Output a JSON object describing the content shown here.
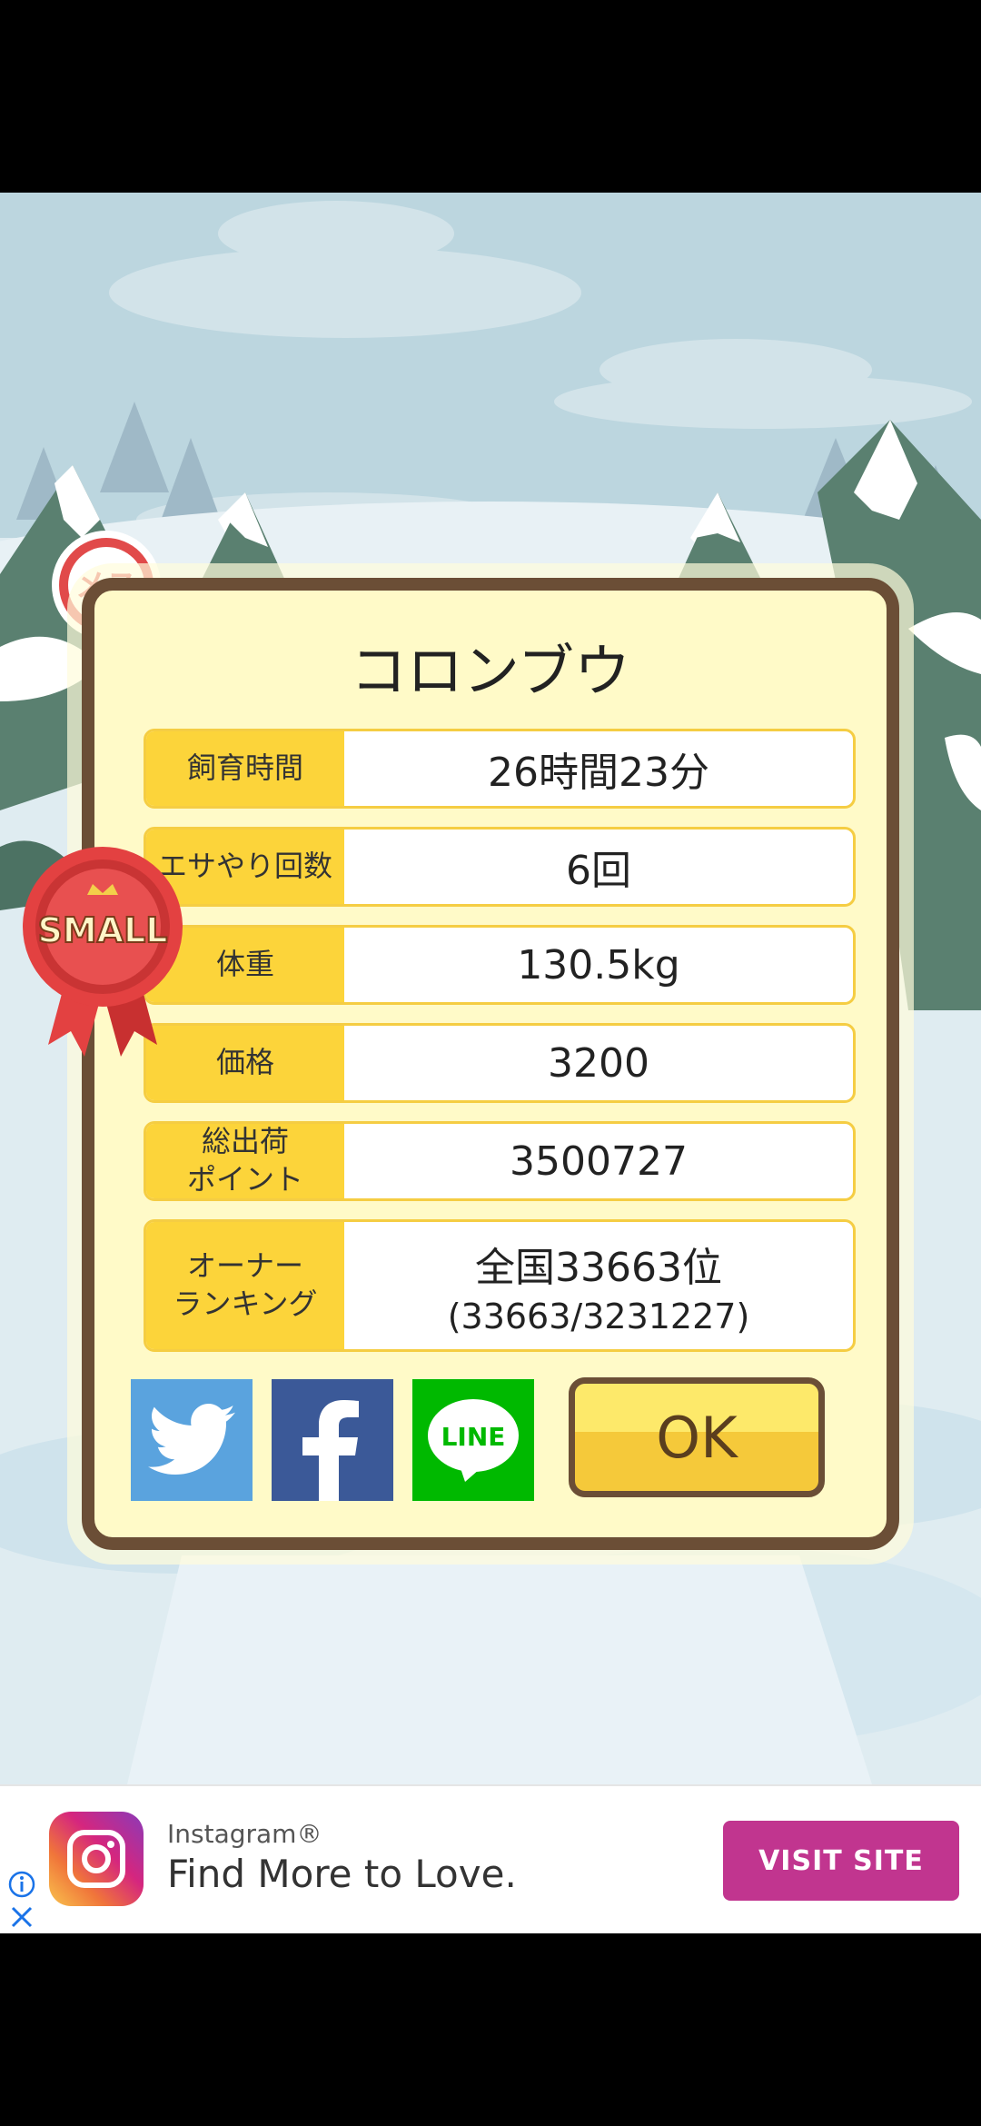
{
  "dialog": {
    "title": "コロンブウ",
    "rows": [
      {
        "label": "飼育時間",
        "value": "26時間23分"
      },
      {
        "label": "エサやり回数",
        "value": "6回"
      },
      {
        "label": "体重",
        "value": "130.5kg"
      },
      {
        "label": "価格",
        "value": "3200"
      },
      {
        "label": "総出荷\nポイント",
        "value": "3500727"
      },
      {
        "label": "オーナー\nランキング",
        "value": "全国33663位",
        "sub": "(33663/3231227)"
      }
    ],
    "share": {
      "twitter_icon": "twitter-bird-icon",
      "facebook_icon": "facebook-f-icon",
      "line_label": "LINE"
    },
    "ok_label": "OK"
  },
  "badges": {
    "female_label": "メス",
    "size_label": "SMALL"
  },
  "ad": {
    "brand": "Instagram®",
    "headline": "Find More to Love.",
    "cta": "VISIT SITE",
    "info_icon": "info-icon",
    "close_icon": "close-icon"
  },
  "colors": {
    "dialog_bg": "#fffac8",
    "dialog_border": "#6b4e36",
    "label_bg": "#fcd43a",
    "twitter": "#5aa3de",
    "facebook": "#3b5998",
    "line": "#00b900",
    "ok_button": "#f5c93a",
    "ad_cta": "#c1358f"
  }
}
